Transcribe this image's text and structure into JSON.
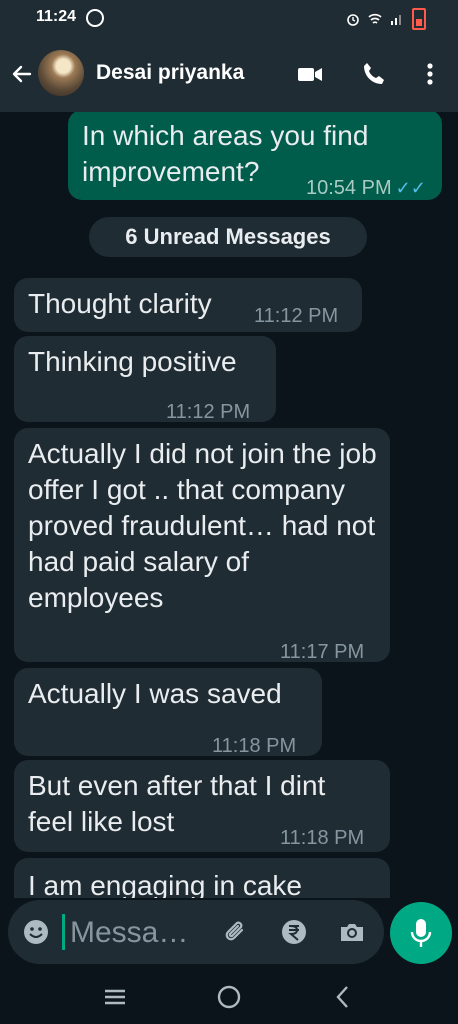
{
  "status_bar": {
    "time": "11:24"
  },
  "header": {
    "contact_name": "Desai priyanka"
  },
  "unread_banner": "6 Unread Messages",
  "messages": [
    {
      "direction": "out",
      "text": "In which areas you find improvement?",
      "time": "10:54 PM",
      "read": true
    },
    {
      "direction": "in",
      "text": "Thought clarity",
      "time": "11:12 PM"
    },
    {
      "direction": "in",
      "text": "Thinking positive",
      "time": "11:12 PM"
    },
    {
      "direction": "in",
      "text": "Actually I did not join the job offer I got .. that company proved fraudulent… had not had paid salary of employees",
      "time": "11:17 PM"
    },
    {
      "direction": "in",
      "text": "Actually I was saved",
      "time": "11:18 PM"
    },
    {
      "direction": "in",
      "text": "But even after that I dint feel like lost",
      "time": "11:18 PM"
    },
    {
      "direction": "in",
      "text": "I am engaging in cake",
      "time": ""
    }
  ],
  "composer": {
    "placeholder": "Messa…"
  },
  "colors": {
    "accent": "#00a884",
    "outgoing_bubble": "#005c4b",
    "incoming_bubble": "#202c33",
    "read_ticks": "#53bdeb"
  }
}
